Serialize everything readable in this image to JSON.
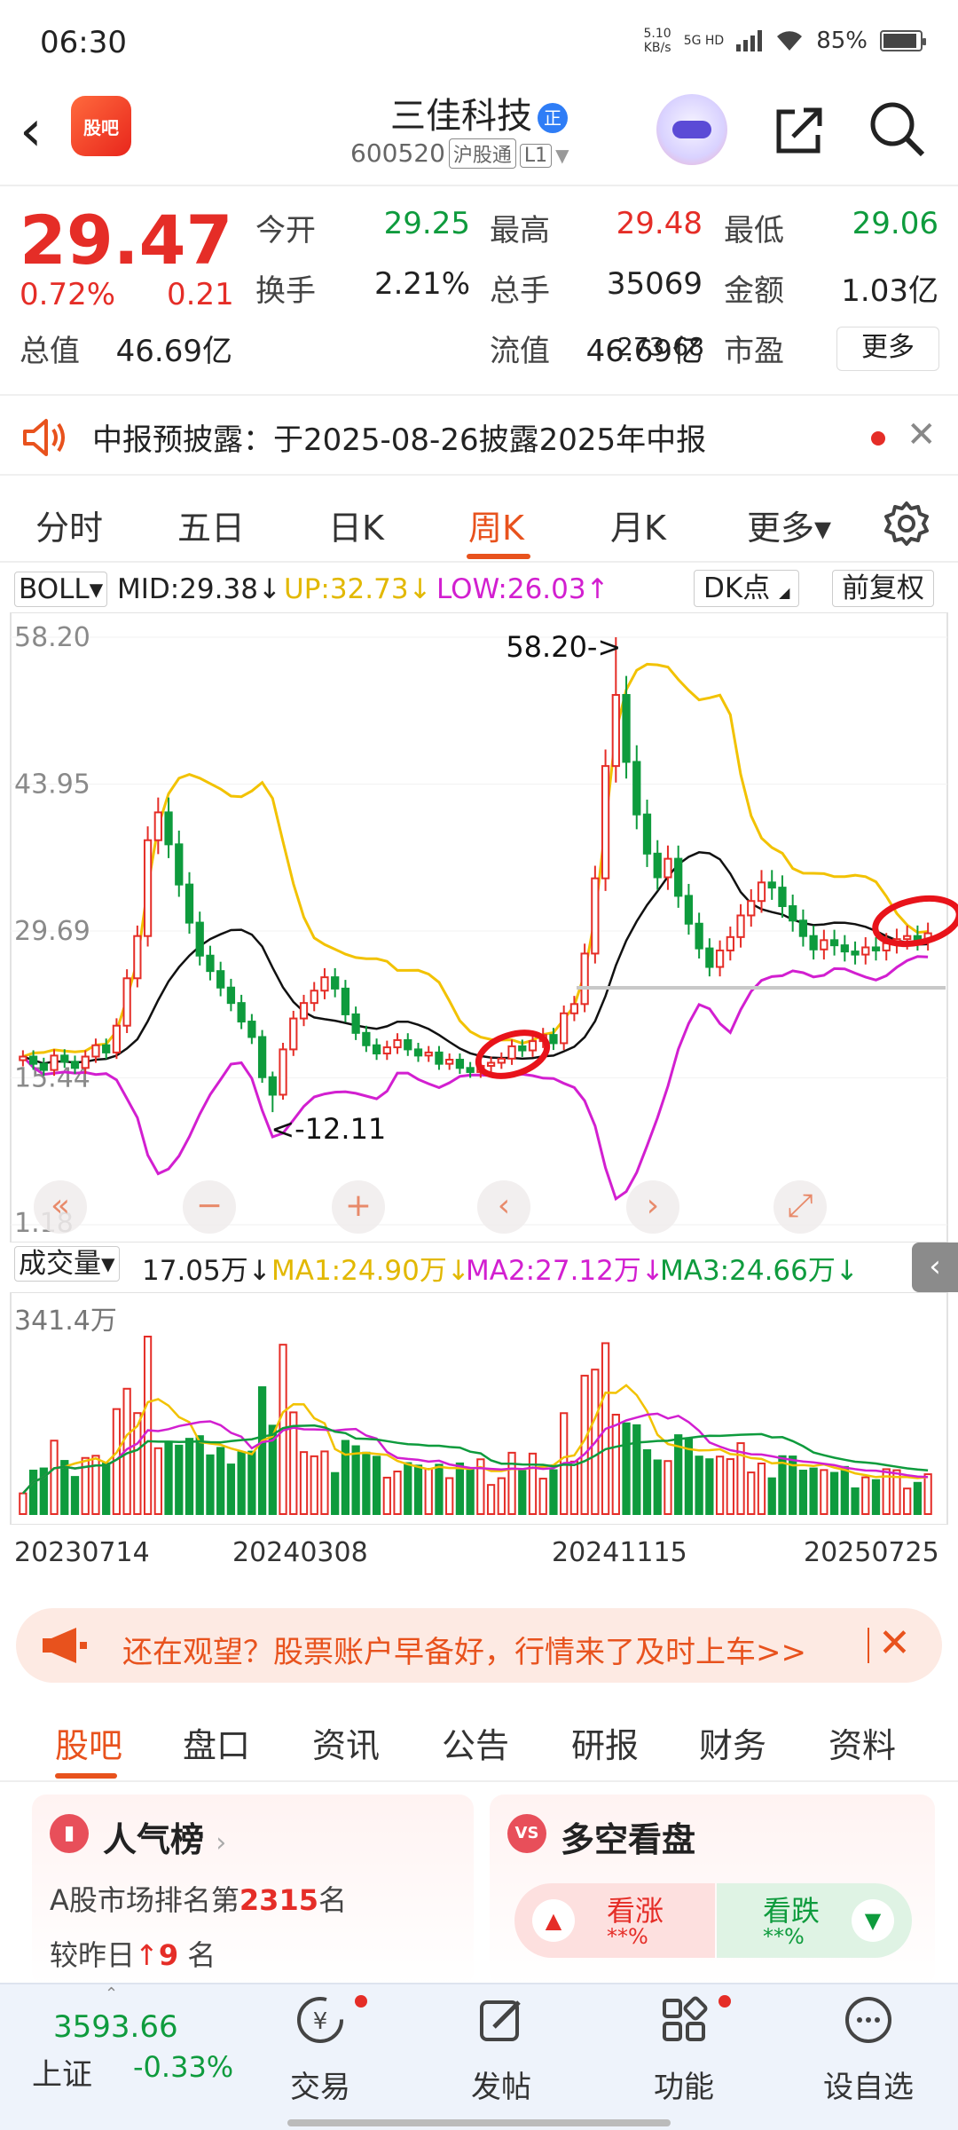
{
  "status_bar": {
    "time": "06:30",
    "net_speed": "5.10",
    "net_unit": "KB/s",
    "network": "5G HD",
    "battery": "85%",
    "battery_level": 0.85
  },
  "header": {
    "logo_text": "股吧",
    "stock_name": "三佳科技",
    "badge": "正",
    "code": "600520",
    "market_tag": "沪股通",
    "level_tag": "L1"
  },
  "quote": {
    "price": "29.47",
    "change_pct": "0.72%",
    "change": "0.21",
    "rows": [
      [
        {
          "label": "今开",
          "value": "29.25",
          "color": "green"
        },
        {
          "label": "最高",
          "value": "29.48",
          "color": "red"
        },
        {
          "label": "最低",
          "value": "29.06",
          "color": "green"
        }
      ],
      [
        {
          "label": "换手",
          "value": "2.21%",
          "color": "dark"
        },
        {
          "label": "总手",
          "value": "35069",
          "color": "dark"
        },
        {
          "label": "金额",
          "value": "1.03亿",
          "color": "dark"
        }
      ],
      [
        {
          "label": "总值",
          "value": "46.69亿",
          "color": "dark"
        },
        {
          "label": "流值",
          "value": "46.69亿",
          "color": "dark"
        },
        {
          "label": "市盈",
          "label_sup": "动",
          "value": "-273.68",
          "color": "dark"
        }
      ]
    ],
    "more_label": "更多"
  },
  "notice": {
    "text": "中报预披露：于2025-08-26披露2025年中报"
  },
  "chart_tabs": [
    "分时",
    "五日",
    "日K",
    "周K",
    "月K",
    "更多▾"
  ],
  "chart_tabs_active": "周K",
  "boll_line": {
    "selector": "BOLL▾",
    "mid": "MID:29.38↓",
    "up": "UP:32.73↓",
    "low": "LOW:26.03↑",
    "dk_btn": "DK点",
    "adj_btn": "前复权"
  },
  "price_axis": [
    "58.20",
    "43.95",
    "29.69",
    "15.44",
    "1.18"
  ],
  "annotations": {
    "high": "58.20->",
    "low": "<-12.11"
  },
  "chart_controls": [
    "«",
    "−",
    "+",
    "‹",
    "›",
    "⤢"
  ],
  "volume_line": {
    "selector": "成交量▾",
    "vol": "17.05万↓",
    "ma1": "MA1:24.90万↓",
    "ma2": "MA2:27.12万↓",
    "ma3": "MA3:24.66万↓"
  },
  "volume_axis_max": "341.4万",
  "date_axis": [
    "20230714",
    "20240308",
    "20241115",
    "20250725"
  ],
  "colors": {
    "up": "#e52d27",
    "down": "#0e9b3d",
    "boll_up": "#f2c200",
    "boll_mid": "#111111",
    "boll_low": "#d21fd0",
    "ma1": "#f2c200",
    "ma2": "#d21fd0",
    "ma3": "#0e9b3d",
    "accent": "#e8521d"
  },
  "ad": {
    "text": "还在观望？股票账户早备好，行情来了及时上车>>"
  },
  "bottom_tabs": [
    "股吧",
    "盘口",
    "资讯",
    "公告",
    "研报",
    "财务",
    "资料"
  ],
  "bottom_tabs_active": "股吧",
  "popularity_card": {
    "title": "人气榜",
    "rank_prefix": "A股市场排名第",
    "rank": "2315",
    "rank_suffix": "名",
    "delta_prefix": "较昨日",
    "delta": "9",
    "delta_suffix": "名"
  },
  "bull_bear_card": {
    "title": "多空看盘",
    "bull": "看涨",
    "bull_pct": "**%",
    "bear": "看跌",
    "bear_pct": "**%"
  },
  "bottom_bar": {
    "index_value": "3593.66",
    "index_name": "上证",
    "index_pct": "-0.33%",
    "nav": [
      {
        "label": "交易",
        "icon": "trade-icon"
      },
      {
        "label": "发帖",
        "icon": "post-icon"
      },
      {
        "label": "功能",
        "icon": "function-icon"
      },
      {
        "label": "设自选",
        "icon": "watchlist-icon"
      }
    ]
  },
  "chart_data": {
    "type": "candlestick",
    "period": "weekly",
    "indicator": "BOLL",
    "ylim": [
      1.18,
      58.2
    ],
    "x_start": "20230714",
    "x_end": "20250725",
    "close_series": [
      17.5,
      16.8,
      16.2,
      17.6,
      17.0,
      16.4,
      17.5,
      18.6,
      17.9,
      20.5,
      25.1,
      29.2,
      38.5,
      41.2,
      38.1,
      34.2,
      30.5,
      27.3,
      25.8,
      24.2,
      22.7,
      20.9,
      19.4,
      15.5,
      13.8,
      18.2,
      21.2,
      22.7,
      23.9,
      25.2,
      24.1,
      21.6,
      19.8,
      18.6,
      17.8,
      18.4,
      19.1,
      18.2,
      17.6,
      17.9,
      16.8,
      17.2,
      16.4,
      16.0,
      16.6,
      16.9,
      17.3,
      18.5,
      18.1,
      19.0,
      19.6,
      18.8,
      21.7,
      22.6,
      27.5,
      34.8,
      45.7,
      52.6,
      46.1,
      41.0,
      37.2,
      34.9,
      36.7,
      33.1,
      30.4,
      28.0,
      26.2,
      27.8,
      29.1,
      31.2,
      32.6,
      34.4,
      33.9,
      32.1,
      30.7,
      29.2,
      27.9,
      28.8,
      28.3,
      27.7,
      27.4,
      28.1,
      27.8,
      28.5,
      28.9,
      29.2,
      28.8,
      29.47
    ]
  }
}
